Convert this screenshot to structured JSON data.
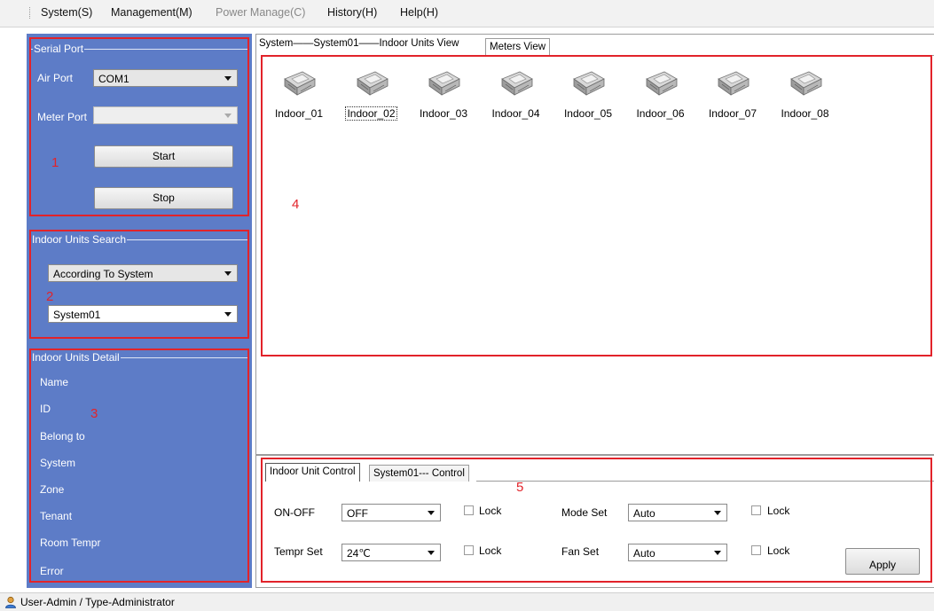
{
  "menu": {
    "items": [
      {
        "label": "System(S)",
        "disabled": false
      },
      {
        "label": "Management(M)",
        "disabled": false
      },
      {
        "label": "Power Manage(C)",
        "disabled": true
      },
      {
        "label": "History(H)",
        "disabled": false
      },
      {
        "label": "Help(H)",
        "disabled": false
      }
    ]
  },
  "serial_port": {
    "title": "Serial Port",
    "air_port_label": "Air Port",
    "air_port_value": "COM1",
    "meter_port_label": "Meter Port",
    "meter_port_value": "",
    "start_label": "Start",
    "stop_label": "Stop"
  },
  "search": {
    "title": "Indoor Units Search",
    "mode_value": "According To System",
    "system_value": "System01"
  },
  "detail": {
    "title": "Indoor Units Detail",
    "fields": [
      "Name",
      "ID",
      "Belong to",
      "System",
      "Zone",
      "Tenant",
      "Room Tempr",
      "Error"
    ]
  },
  "view": {
    "breadcrumb": "System——System01——Indoor Units View",
    "meters_tab": "Meters View",
    "units": [
      "Indoor_01",
      "Indoor_02",
      "Indoor_03",
      "Indoor_04",
      "Indoor_05",
      "Indoor_06",
      "Indoor_07",
      "Indoor_08"
    ],
    "selected_unit": "Indoor_02"
  },
  "control": {
    "tab_active": "Indoor Unit Control",
    "tab_other": "System01--- Control",
    "onoff_label": "ON-OFF",
    "onoff_value": "OFF",
    "tempr_label": "Tempr Set",
    "tempr_value": "24℃",
    "mode_label": "Mode Set",
    "mode_value": "Auto",
    "fan_label": "Fan Set",
    "fan_value": "Auto",
    "lock_label": "Lock",
    "apply_label": "Apply"
  },
  "annotations": [
    "1",
    "2",
    "3",
    "4",
    "5"
  ],
  "status": {
    "text": "User-Admin / Type-Administrator"
  },
  "colors": {
    "panel_blue": "#5d7cc7",
    "annotation_red": "#e2232a"
  }
}
